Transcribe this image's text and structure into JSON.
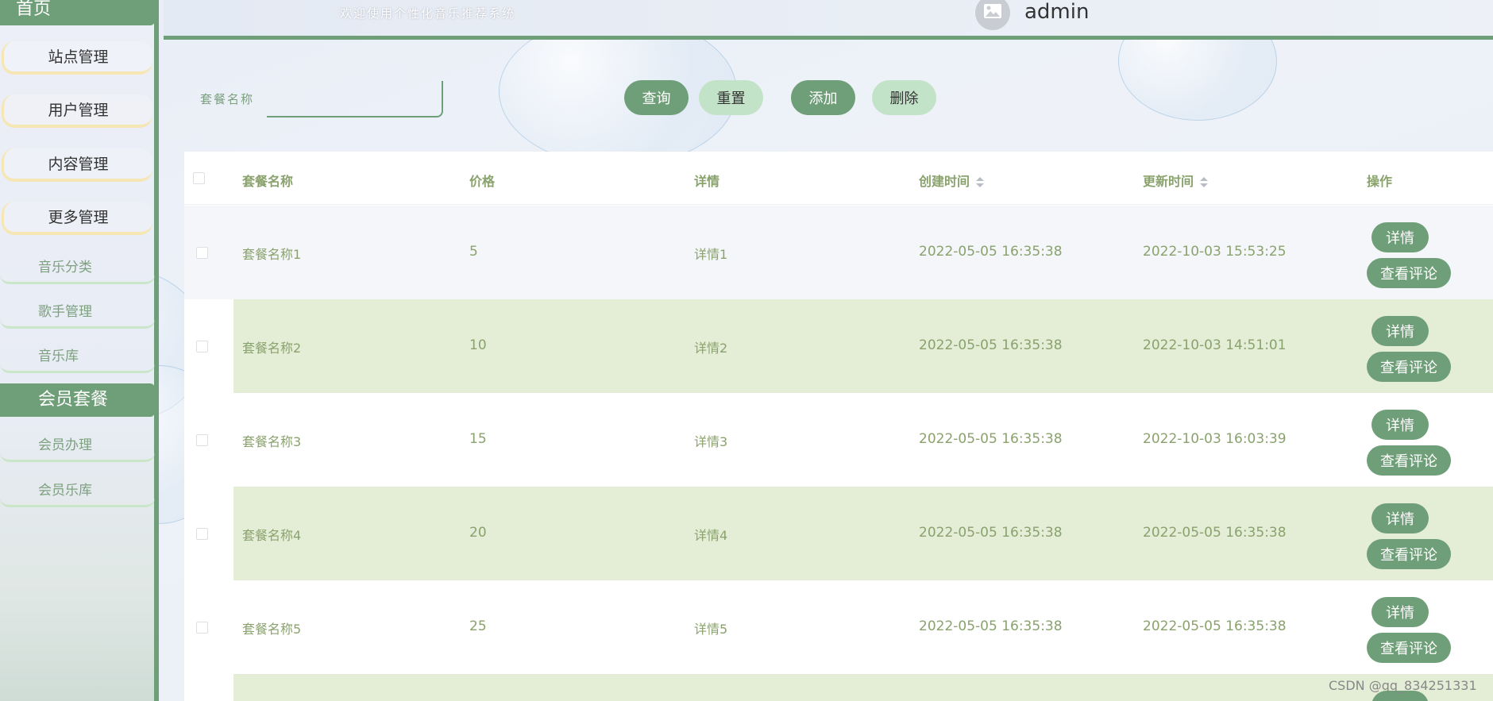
{
  "sidebar": {
    "home": "首页",
    "groups": [
      "站点管理",
      "用户管理",
      "内容管理",
      "更多管理"
    ],
    "subs1": [
      "音乐分类",
      "歌手管理",
      "音乐库"
    ],
    "section": "会员套餐",
    "subs2": [
      "会员办理",
      "会员乐库"
    ]
  },
  "header": {
    "welcome": "欢迎使用个性化音乐推荐系统",
    "username": "admin",
    "avatar_icon": "image-placeholder-icon"
  },
  "search": {
    "label": "套餐名称",
    "value": "",
    "query_label": "查询",
    "reset_label": "重置",
    "add_label": "添加",
    "delete_label": "删除"
  },
  "table": {
    "headers": [
      "套餐名称",
      "价格",
      "详情",
      "创建时间",
      "更新时间",
      "操作"
    ],
    "rows": [
      {
        "name": "套餐名称1",
        "price": "5",
        "detail": "详情1",
        "created": "2022-05-05 16:35:38",
        "updated": "2022-10-03 15:53:25"
      },
      {
        "name": "套餐名称2",
        "price": "10",
        "detail": "详情2",
        "created": "2022-05-05 16:35:38",
        "updated": "2022-10-03 14:51:01"
      },
      {
        "name": "套餐名称3",
        "price": "15",
        "detail": "详情3",
        "created": "2022-05-05 16:35:38",
        "updated": "2022-10-03 16:03:39"
      },
      {
        "name": "套餐名称4",
        "price": "20",
        "detail": "详情4",
        "created": "2022-05-05 16:35:38",
        "updated": "2022-05-05 16:35:38"
      },
      {
        "name": "套餐名称5",
        "price": "25",
        "detail": "详情5",
        "created": "2022-05-05 16:35:38",
        "updated": "2022-05-05 16:35:38"
      }
    ],
    "detail_btn": "详情",
    "comment_btn": "查看评论"
  },
  "watermark": "CSDN @qq_834251331",
  "colors": {
    "accent": "#6f9f78",
    "light_accent": "#c3e3c8",
    "row_green": "#e4edd6",
    "text_green": "#8aa26d"
  }
}
